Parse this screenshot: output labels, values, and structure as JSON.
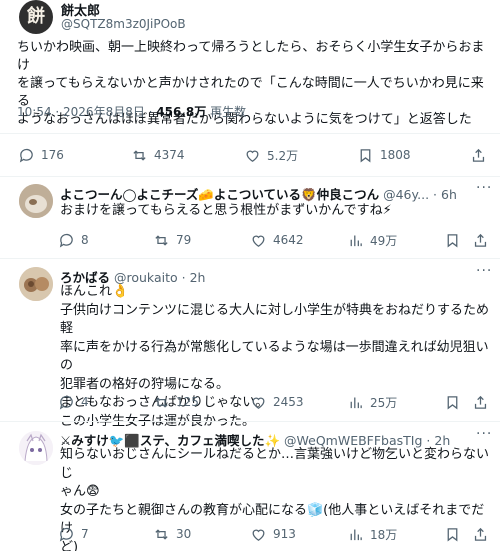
{
  "main_post": {
    "author_name": "餅太郎",
    "author_handle": "@SQTZ8m3z0JiPOoB",
    "avatar_glyph": "餅",
    "text_line1": "ちいかわ映画、朝一上映終わって帰ろうとしたら、おそらく小学生女子からおまけ",
    "text_line2": "を譲ってもらえないかと声かけされたので「こんな時間に一人でちいかわ見に来る",
    "text_line3": "ようなおっさんはほぼ異常者だから関わらないように気をつけて」と返答した",
    "time": "10:54 · 2026年8月8日 · ",
    "views_count": "456.8万",
    "views_label": " 再生数",
    "replies": "176",
    "reposts": "4374",
    "likes": "5.2万",
    "bookmarks": "1808"
  },
  "replies": [
    {
      "name": "よこつーん◯よこチーズ🧀よこついている🦁仲良こつん",
      "handle": "@46y...",
      "age": "· 6h",
      "text_lines": [
        "おまけを譲ってもらえると思う根性がまずいかんですね⚡"
      ],
      "replies": "8",
      "reposts": "79",
      "likes": "4642",
      "views": "49万"
    },
    {
      "name": "ろかばる",
      "handle": "@roukaito",
      "age": "· 2h",
      "text_lines": [
        "ほんこれ👌",
        "子供向けコンテンツに混じる大人に対し小学生が特典をおねだりするため軽",
        "率に声をかける行為が常態化しているような場は一歩間違えれば幼児狙いの",
        "犯罪者の格好の狩場になる。",
        "まともなおっさんばかりじゃない。",
        "この小学生女子は運が良かった。"
      ],
      "replies": "4",
      "reposts": "125",
      "likes": "2453",
      "views": "25万"
    },
    {
      "name": "⚔みすけ🐦⬛ステ、カフェ満喫した✨",
      "handle": "@WeQmWEBFFbasTIg",
      "age": "· 2h",
      "text_lines": [
        "知らないおじさんにシールねだるとか…言葉強いけど物乞いと変わらないじ",
        "ゃん😨",
        "女の子たちと親御さんの教育が心配になる🧊(他人事といえばそれまでだけ",
        "ど)"
      ],
      "replies": "7",
      "reposts": "30",
      "likes": "913",
      "views": "18万"
    }
  ]
}
